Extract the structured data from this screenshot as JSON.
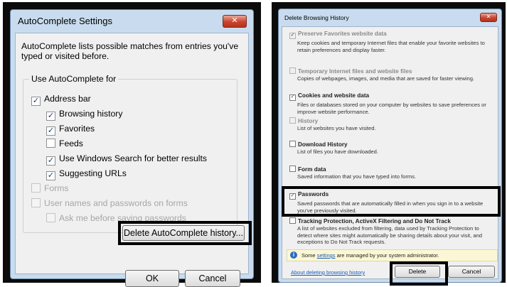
{
  "autocomplete": {
    "title": "AutoComplete Settings",
    "close_glyph": "✕",
    "description": "AutoComplete lists possible matches from entries you've typed or visited before.",
    "group_label": "Use AutoComplete for",
    "options": {
      "address_bar": {
        "label": "Address bar",
        "checked": true
      },
      "browsing_history": {
        "label": "Browsing history",
        "checked": true
      },
      "favorites": {
        "label": "Favorites",
        "checked": true
      },
      "feeds": {
        "label": "Feeds",
        "checked": false
      },
      "windows_search": {
        "label": "Use Windows Search for better results",
        "checked": true
      },
      "suggesting_urls": {
        "label": "Suggesting URLs",
        "checked": true
      },
      "forms": {
        "label": "Forms",
        "checked": false,
        "disabled": true
      },
      "usernames_passwords": {
        "label": "User names and passwords on forms",
        "checked": false,
        "disabled": true
      },
      "ask_before_saving": {
        "label": "Ask me before saving passwords",
        "checked": false,
        "disabled": true
      }
    },
    "delete_history_button": "Delete AutoComplete history...",
    "ok_button": "OK",
    "cancel_button": "Cancel"
  },
  "delete_history": {
    "title": "Delete Browsing History",
    "close_glyph": "✕",
    "items": {
      "preserve_favorites": {
        "label": "Preserve Favorites website data",
        "desc": "Keep cookies and temporary Internet files that enable your favorite websites to retain preferences and display faster.",
        "checked": true,
        "disabled": true
      },
      "temp_files": {
        "label": "Temporary Internet files and website files",
        "desc": "Copies of webpages, images, and media that are saved for faster viewing.",
        "checked": false,
        "disabled": true
      },
      "cookies": {
        "label": "Cookies and website data",
        "desc": "Files or databases stored on your computer by websites to save preferences or improve website performance.",
        "checked": true,
        "disabled": false
      },
      "history": {
        "label": "History",
        "desc": "List of websites you have visited.",
        "checked": false,
        "disabled": true
      },
      "download_history": {
        "label": "Download History",
        "desc": "List of files you have downloaded.",
        "checked": false,
        "disabled": false
      },
      "form_data": {
        "label": "Form data",
        "desc": "Saved information that you have typed into forms.",
        "checked": false,
        "disabled": false
      },
      "passwords": {
        "label": "Passwords",
        "desc": "Saved passwords that are automatically filled in when you sign in to a website you've previously visited.",
        "checked": true,
        "disabled": false
      },
      "tracking": {
        "label": "Tracking Protection, ActiveX Filtering and Do Not Track",
        "desc": "A list of websites excluded from filtering, data used by Tracking Protection to detect where sites might automatically be sharing details about your visit, and exceptions to Do Not Track requests.",
        "checked": false,
        "disabled": false
      }
    },
    "info_icon": "i",
    "info_prefix": "Some",
    "info_link": "settings",
    "info_suffix": "are managed by your system administrator.",
    "about_link": "About deleting browsing history",
    "delete_button": "Delete",
    "cancel_button": "Cancel"
  }
}
